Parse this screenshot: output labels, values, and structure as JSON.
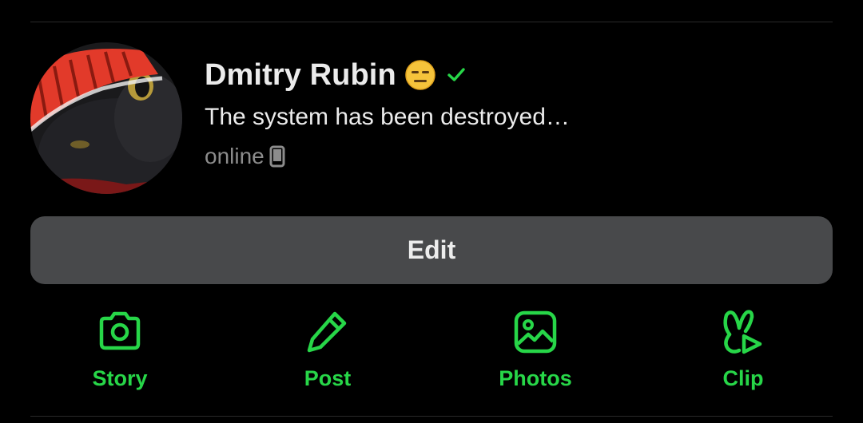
{
  "profile": {
    "name": "Dmitry Rubin",
    "emoji": "expressionless-face-emoji",
    "verified_icon": "check-icon",
    "bio": "The system has been destroyed…",
    "status": "online",
    "status_icon": "phone-icon"
  },
  "edit_button": {
    "label": "Edit"
  },
  "actions": [
    {
      "label": "Story",
      "icon": "camera-icon"
    },
    {
      "label": "Post",
      "icon": "pencil-icon"
    },
    {
      "label": "Photos",
      "icon": "image-icon"
    },
    {
      "label": "Clip",
      "icon": "clip-icon"
    }
  ],
  "colors": {
    "background": "#000000",
    "accent": "#27d648",
    "button": "#48494b",
    "text_primary": "#ebebeb",
    "text_secondary": "#8c8c8c"
  }
}
